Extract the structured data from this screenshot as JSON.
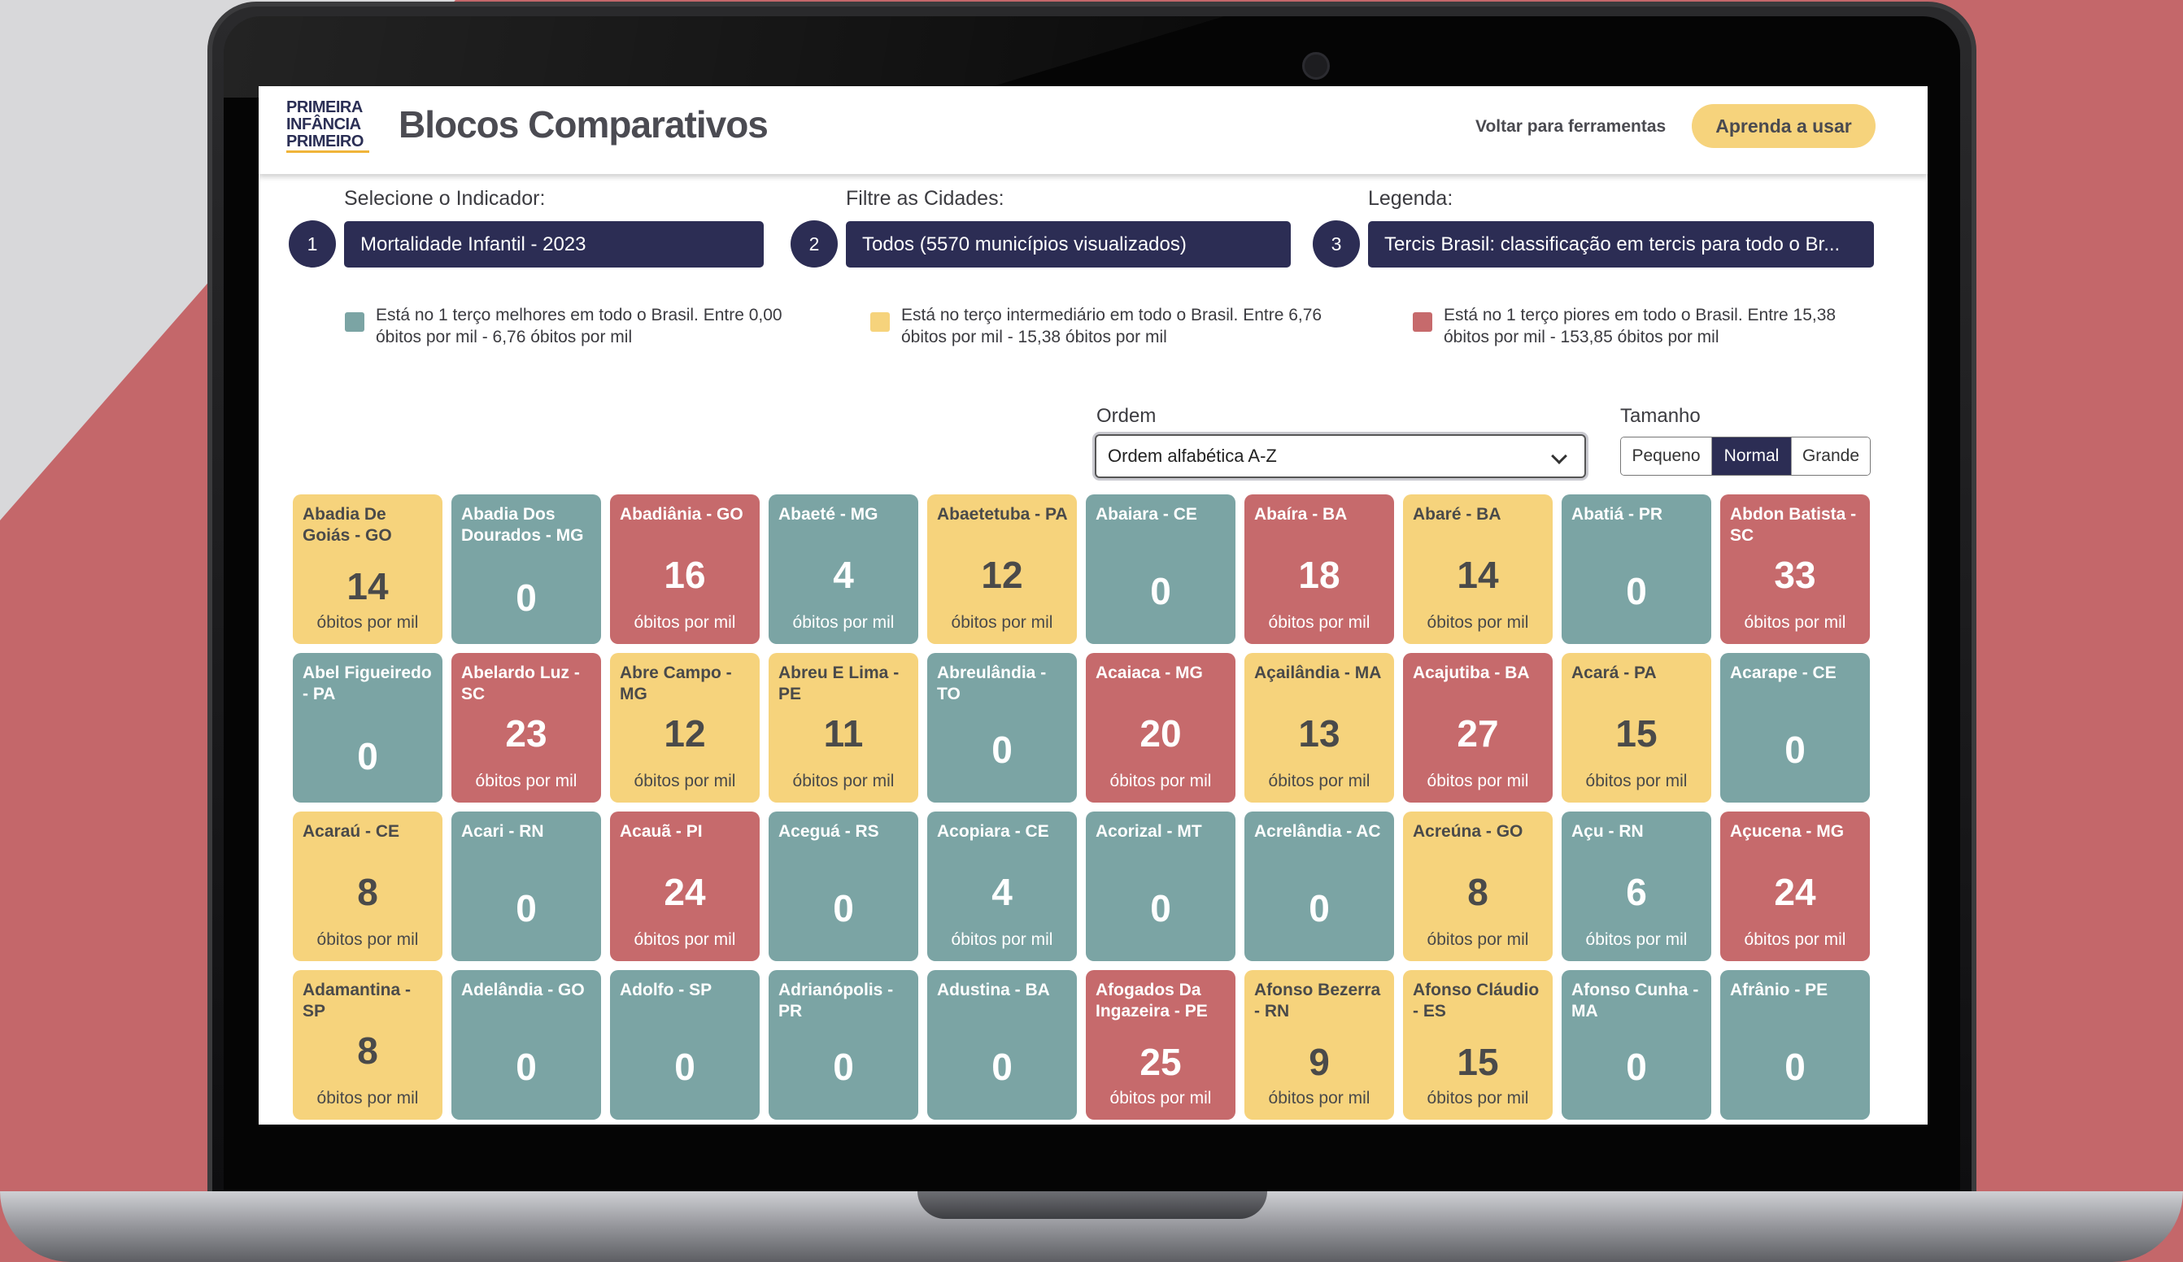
{
  "header": {
    "logo_lines": [
      "PRIMEIRA",
      "INFÂNCIA",
      "PRIMEIRO"
    ],
    "title": "Blocos Comparativos",
    "back_link": "Voltar para ferramentas",
    "learn_button": "Aprenda a usar"
  },
  "controls": {
    "indicator": {
      "step": "1",
      "label": "Selecione o Indicador:",
      "value": "Mortalidade Infantil - 2023"
    },
    "cities": {
      "step": "2",
      "label": "Filtre as Cidades:",
      "value": "Todos (5570 municípios visualizados)"
    },
    "legend": {
      "step": "3",
      "label": "Legenda:",
      "value": "Tercis Brasil: classificação em tercis para todo o Br..."
    }
  },
  "legend_items": [
    {
      "color": "#7ba4a4",
      "text_line1": "Está no 1 terço melhores em todo o Brasil. Entre 0,00",
      "text_line2": "óbitos por mil - 6,76 óbitos por mil"
    },
    {
      "color": "#f6d37c",
      "text_line1": "Está no terço intermediário em todo o Brasil. Entre 6,76",
      "text_line2": "óbitos por mil - 15,38 óbitos por mil"
    },
    {
      "color": "#c66a6c",
      "text_line1": "Está no 1 terço piores em todo o Brasil. Entre 15,38",
      "text_line2": "óbitos por mil - 153,85 óbitos por mil"
    }
  ],
  "ordem": {
    "label": "Ordem",
    "value": "Ordem alfabética A-Z"
  },
  "tamanho": {
    "label": "Tamanho",
    "options": [
      "Pequeno",
      "Normal",
      "Grande"
    ],
    "selected": "Normal"
  },
  "colors": {
    "green": "#7ba4a4",
    "yellow": "#f6d37c",
    "red": "#c66a6c",
    "navy": "#2c2d54"
  },
  "unit": "óbitos por mil",
  "tiles": [
    {
      "name": "Abadia De Goiás - GO",
      "value": "14",
      "color": "yellow",
      "unit": true
    },
    {
      "name": "Abadia Dos Dourados - MG",
      "value": "0",
      "color": "green",
      "unit": false
    },
    {
      "name": "Abadiânia - GO",
      "value": "16",
      "color": "red",
      "unit": true
    },
    {
      "name": "Abaeté - MG",
      "value": "4",
      "color": "green",
      "unit": true
    },
    {
      "name": "Abaetetuba - PA",
      "value": "12",
      "color": "yellow",
      "unit": true
    },
    {
      "name": "Abaiara - CE",
      "value": "0",
      "color": "green",
      "unit": false
    },
    {
      "name": "Abaíra - BA",
      "value": "18",
      "color": "red",
      "unit": true
    },
    {
      "name": "Abaré - BA",
      "value": "14",
      "color": "yellow",
      "unit": true
    },
    {
      "name": "Abatiá - PR",
      "value": "0",
      "color": "green",
      "unit": false
    },
    {
      "name": "Abdon Batista - SC",
      "value": "33",
      "color": "red",
      "unit": true
    },
    {
      "name": "Abel Figueiredo - PA",
      "value": "0",
      "color": "green",
      "unit": false
    },
    {
      "name": "Abelardo Luz - SC",
      "value": "23",
      "color": "red",
      "unit": true
    },
    {
      "name": "Abre Campo - MG",
      "value": "12",
      "color": "yellow",
      "unit": true
    },
    {
      "name": "Abreu E Lima - PE",
      "value": "11",
      "color": "yellow",
      "unit": true
    },
    {
      "name": "Abreulândia - TO",
      "value": "0",
      "color": "green",
      "unit": false
    },
    {
      "name": "Acaiaca - MG",
      "value": "20",
      "color": "red",
      "unit": true
    },
    {
      "name": "Açailândia - MA",
      "value": "13",
      "color": "yellow",
      "unit": true
    },
    {
      "name": "Acajutiba - BA",
      "value": "27",
      "color": "red",
      "unit": true
    },
    {
      "name": "Acará - PA",
      "value": "15",
      "color": "yellow",
      "unit": true
    },
    {
      "name": "Acarape - CE",
      "value": "0",
      "color": "green",
      "unit": false
    },
    {
      "name": "Acaraú - CE",
      "value": "8",
      "color": "yellow",
      "unit": true
    },
    {
      "name": "Acari - RN",
      "value": "0",
      "color": "green",
      "unit": false
    },
    {
      "name": "Acauã - PI",
      "value": "24",
      "color": "red",
      "unit": true
    },
    {
      "name": "Aceguá - RS",
      "value": "0",
      "color": "green",
      "unit": false
    },
    {
      "name": "Acopiara - CE",
      "value": "4",
      "color": "green",
      "unit": true
    },
    {
      "name": "Acorizal - MT",
      "value": "0",
      "color": "green",
      "unit": false
    },
    {
      "name": "Acrelândia - AC",
      "value": "0",
      "color": "green",
      "unit": false
    },
    {
      "name": "Acreúna - GO",
      "value": "8",
      "color": "yellow",
      "unit": true
    },
    {
      "name": "Açu - RN",
      "value": "6",
      "color": "green",
      "unit": true
    },
    {
      "name": "Açucena - MG",
      "value": "24",
      "color": "red",
      "unit": true
    },
    {
      "name": "Adamantina - SP",
      "value": "8",
      "color": "yellow",
      "unit": true
    },
    {
      "name": "Adelândia - GO",
      "value": "0",
      "color": "green",
      "unit": false
    },
    {
      "name": "Adolfo - SP",
      "value": "0",
      "color": "green",
      "unit": false
    },
    {
      "name": "Adrianópolis - PR",
      "value": "0",
      "color": "green",
      "unit": false
    },
    {
      "name": "Adustina - BA",
      "value": "0",
      "color": "green",
      "unit": false
    },
    {
      "name": "Afogados Da Ingazeira - PE",
      "value": "25",
      "color": "red",
      "unit": true
    },
    {
      "name": "Afonso Bezerra - RN",
      "value": "9",
      "color": "yellow",
      "unit": true
    },
    {
      "name": "Afonso Cláudio - ES",
      "value": "15",
      "color": "yellow",
      "unit": true
    },
    {
      "name": "Afonso Cunha - MA",
      "value": "0",
      "color": "green",
      "unit": false
    },
    {
      "name": "Afrânio - PE",
      "value": "0",
      "color": "green",
      "unit": false
    }
  ]
}
